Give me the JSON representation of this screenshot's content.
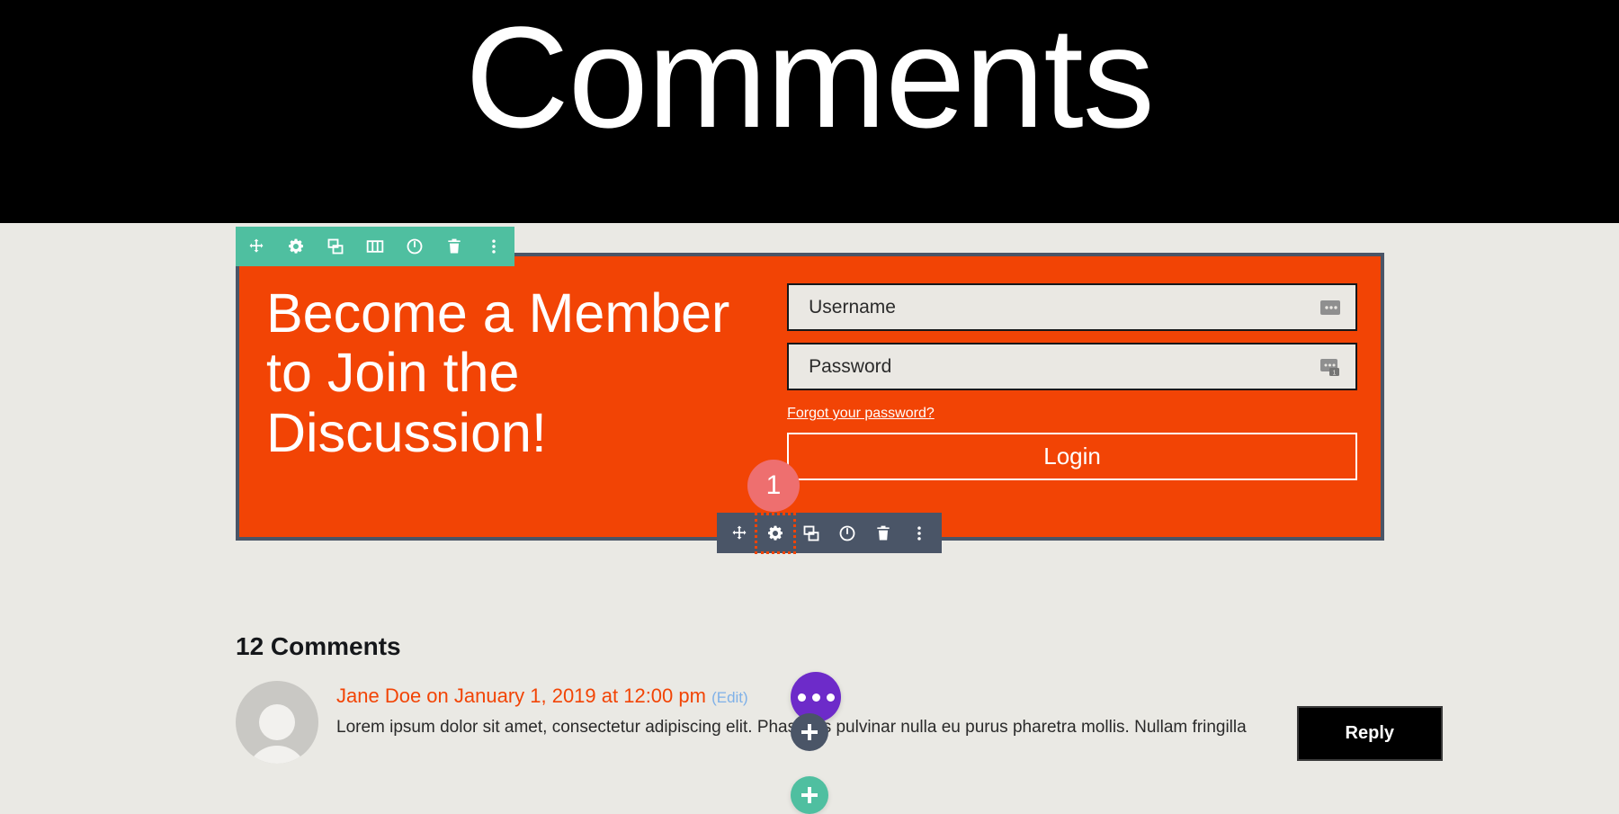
{
  "header": {
    "title": "Comments"
  },
  "row_toolbar": {
    "icons": [
      {
        "name": "move-icon",
        "label": "Move"
      },
      {
        "name": "gear-icon",
        "label": "Settings"
      },
      {
        "name": "duplicate-icon",
        "label": "Duplicate"
      },
      {
        "name": "columns-icon",
        "label": "Columns"
      },
      {
        "name": "power-icon",
        "label": "Disable"
      },
      {
        "name": "trash-icon",
        "label": "Delete"
      },
      {
        "name": "more-vertical-icon",
        "label": "More"
      }
    ]
  },
  "module_toolbar": {
    "icons": [
      {
        "name": "move-icon",
        "label": "Move",
        "active": false
      },
      {
        "name": "gear-icon",
        "label": "Settings",
        "active": true
      },
      {
        "name": "duplicate-icon",
        "label": "Duplicate",
        "active": false
      },
      {
        "name": "power-icon",
        "label": "Disable",
        "active": false
      },
      {
        "name": "trash-icon",
        "label": "Delete",
        "active": false
      },
      {
        "name": "more-vertical-icon",
        "label": "More",
        "active": false
      }
    ]
  },
  "step_badge": {
    "number": "1"
  },
  "cta": {
    "heading": "Become a Member to Join the Discussion!",
    "username": {
      "placeholder": "Username",
      "value": "Username",
      "icon": "password-manager-icon"
    },
    "password": {
      "placeholder": "Password",
      "value": "Password",
      "icon": "password-manager-saved-icon"
    },
    "forgot_link": "Forgot your password?",
    "login_label": "Login",
    "accent_color": "#f24405",
    "border_color": "#4a5567"
  },
  "add_buttons": {
    "module_add_label": "+",
    "row_add_label": "+"
  },
  "comments": {
    "count_title": "12 Comments",
    "items": [
      {
        "author": "Jane Doe",
        "meta": "Jane Doe on January 1, 2019 at 12:00 pm",
        "edit_label": "(Edit)",
        "text": "Lorem ipsum dolor sit amet, consectetur adipiscing elit. Phasellus pulvinar nulla eu purus pharetra mollis. Nullam fringilla",
        "reply_label": "Reply"
      }
    ],
    "more_button": {
      "name": "more-options-button",
      "dots": 3,
      "color": "#6d2bc9"
    }
  }
}
